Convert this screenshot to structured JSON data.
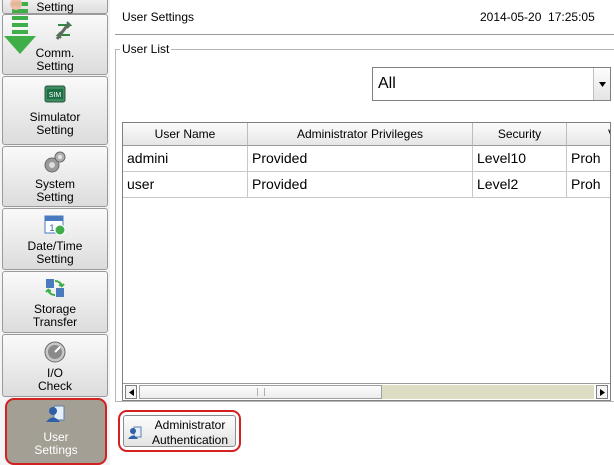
{
  "sidebar": {
    "items": [
      {
        "label": "Setting",
        "icon": "top-setting-icon"
      },
      {
        "label": "Comm.\nSetting",
        "icon": "comm-arrows-icon"
      },
      {
        "label": "Simulator\nSetting",
        "icon": "sim-chip-icon"
      },
      {
        "label": "System\nSetting",
        "icon": "gears-icon"
      },
      {
        "label": "Date/Time\nSetting",
        "icon": "calendar-clock-icon"
      },
      {
        "label": "Storage\nTransfer",
        "icon": "storage-transfer-icon"
      },
      {
        "label": "I/O\nCheck",
        "icon": "gauge-icon"
      },
      {
        "label": "User\nSettings",
        "icon": "user-icon",
        "active": true
      }
    ]
  },
  "header": {
    "title": "User Settings",
    "datetime": "2014-05-20  17:25:05"
  },
  "user_list": {
    "group_label": "User List",
    "filter_value": "All"
  },
  "table": {
    "columns": [
      "User Name",
      "Administrator Privileges",
      "Security",
      "V"
    ],
    "rows": [
      [
        "admini",
        "Provided",
        "Level10",
        "Proh"
      ],
      [
        "user",
        "Provided",
        "Level2",
        "Proh"
      ]
    ]
  },
  "auth_button": {
    "line1": "Administrator",
    "line2": "Authentication"
  },
  "colors": {
    "highlight": "#d32020",
    "active_bg": "#a49f94",
    "scroll_track": "#dedcc2"
  }
}
